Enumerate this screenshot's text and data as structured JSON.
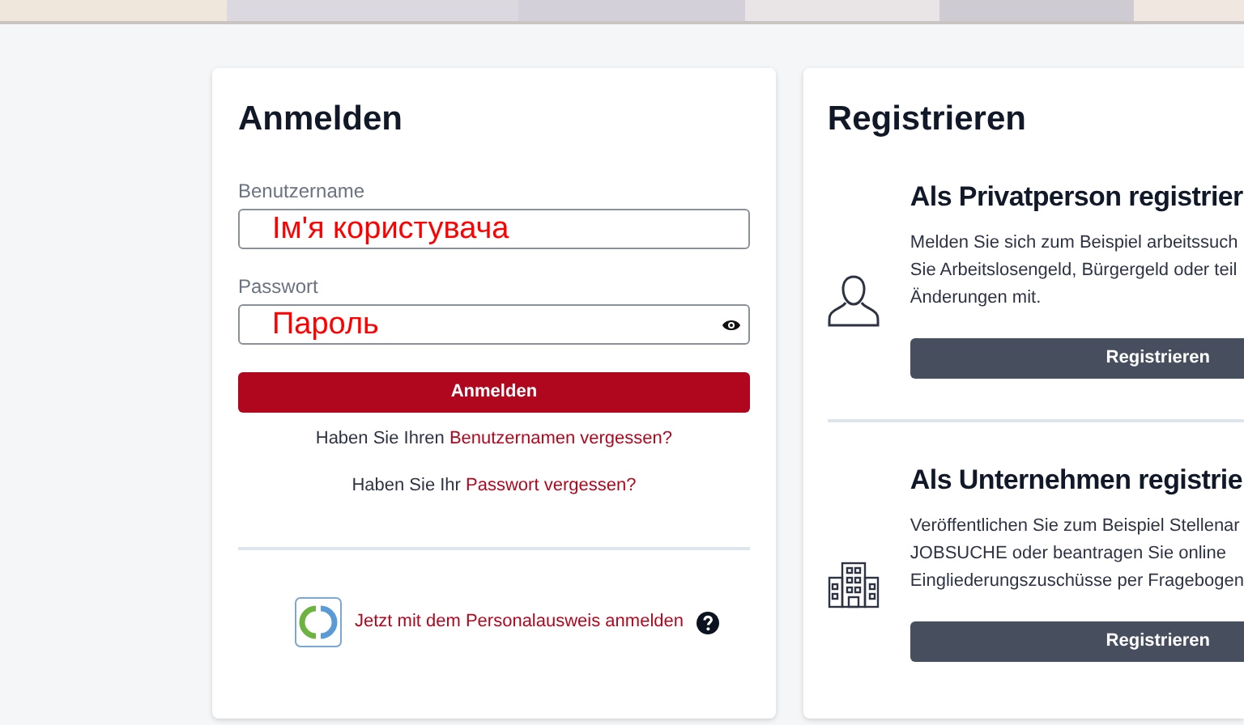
{
  "login": {
    "title": "Anmelden",
    "fields": [
      {
        "kind": "text",
        "label": "Benutzername",
        "value": "Ім'я користувача"
      },
      {
        "kind": "password",
        "label": "Passwort",
        "value": "Пароль"
      }
    ],
    "submit": "Anmelden",
    "help_links": [
      {
        "prefix": "Haben Sie Ihren",
        "link": "Benutzernamen vergessen?"
      },
      {
        "prefix": "Haben Sie Ihr",
        "link": "Passwort vergessen?"
      }
    ],
    "eid_link": "Jetzt mit dem Personalausweis anmelden"
  },
  "register": {
    "title": "Registrieren",
    "sections": [
      {
        "kind": "person",
        "title": "Als Privatperson registrier",
        "description_lines": [
          "Melden Sie sich zum Beispiel arbeitssuch",
          "Sie Arbeitslosengeld, Bürgergeld oder teil",
          "Änderungen mit."
        ],
        "button": "Registrieren"
      },
      {
        "kind": "company",
        "title": "Als Unternehmen registrie",
        "description_lines": [
          "Veröffentlichen Sie zum Beispiel Stellenar",
          "JOBSUCHE oder beantragen Sie online",
          "Eingliederungszuschüsse per Fragebogen"
        ],
        "button": "Registrieren"
      }
    ]
  }
}
